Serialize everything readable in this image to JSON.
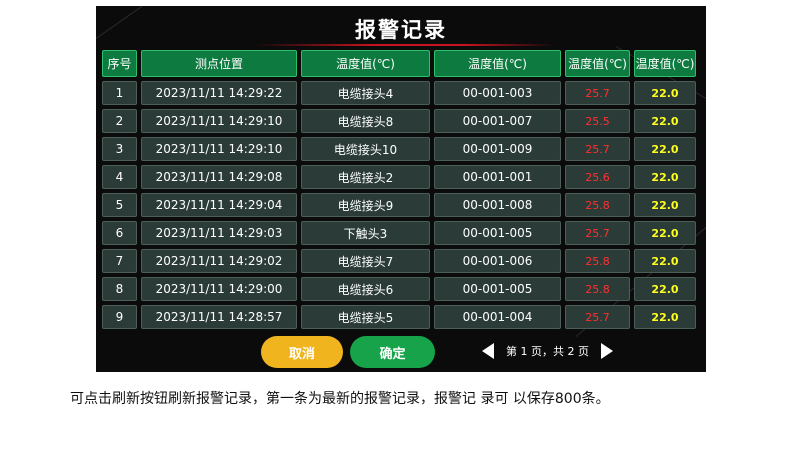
{
  "title": "报警记录",
  "headers": [
    "序号",
    "测点位置",
    "温度值(℃)",
    "温度值(℃)",
    "温度值(℃)",
    "温度值(℃)"
  ],
  "rows": [
    {
      "no": "1",
      "time": "2023/11/11 14:29:22",
      "name": "电缆接头4",
      "code": "00-001-003",
      "temp": "25.7",
      "limit": "22.0"
    },
    {
      "no": "2",
      "time": "2023/11/11 14:29:10",
      "name": "电缆接头8",
      "code": "00-001-007",
      "temp": "25.5",
      "limit": "22.0"
    },
    {
      "no": "3",
      "time": "2023/11/11 14:29:10",
      "name": "电缆接头10",
      "code": "00-001-009",
      "temp": "25.7",
      "limit": "22.0"
    },
    {
      "no": "4",
      "time": "2023/11/11 14:29:08",
      "name": "电缆接头2",
      "code": "00-001-001",
      "temp": "25.6",
      "limit": "22.0"
    },
    {
      "no": "5",
      "time": "2023/11/11 14:29:04",
      "name": "电缆接头9",
      "code": "00-001-008",
      "temp": "25.8",
      "limit": "22.0"
    },
    {
      "no": "6",
      "time": "2023/11/11 14:29:03",
      "name": "下触头3",
      "code": "00-001-005",
      "temp": "25.7",
      "limit": "22.0"
    },
    {
      "no": "7",
      "time": "2023/11/11 14:29:02",
      "name": "电缆接头7",
      "code": "00-001-006",
      "temp": "25.8",
      "limit": "22.0"
    },
    {
      "no": "8",
      "time": "2023/11/11 14:29:00",
      "name": "电缆接头6",
      "code": "00-001-005",
      "temp": "25.8",
      "limit": "22.0"
    },
    {
      "no": "9",
      "time": "2023/11/11 14:28:57",
      "name": "电缆接头5",
      "code": "00-001-004",
      "temp": "25.7",
      "limit": "22.0"
    }
  ],
  "buttons": {
    "cancel": "取消",
    "confirm": "确定"
  },
  "pager": {
    "text": "第 1 页，共 2 页",
    "prev_icon": "triangle-left-icon",
    "next_icon": "triangle-right-icon"
  },
  "caption": "可点击刷新按钮刷新报警记录，第一条为最新的报警记录，报警记 录可 以保存800条。",
  "colors": {
    "header_bg": "#0d7a3f",
    "row_bg": "#2b3c38",
    "alarm_value": "#ff3030",
    "limit_value": "#ffff20",
    "cancel_btn": "#f0b51e",
    "confirm_btn": "#16a34a"
  }
}
